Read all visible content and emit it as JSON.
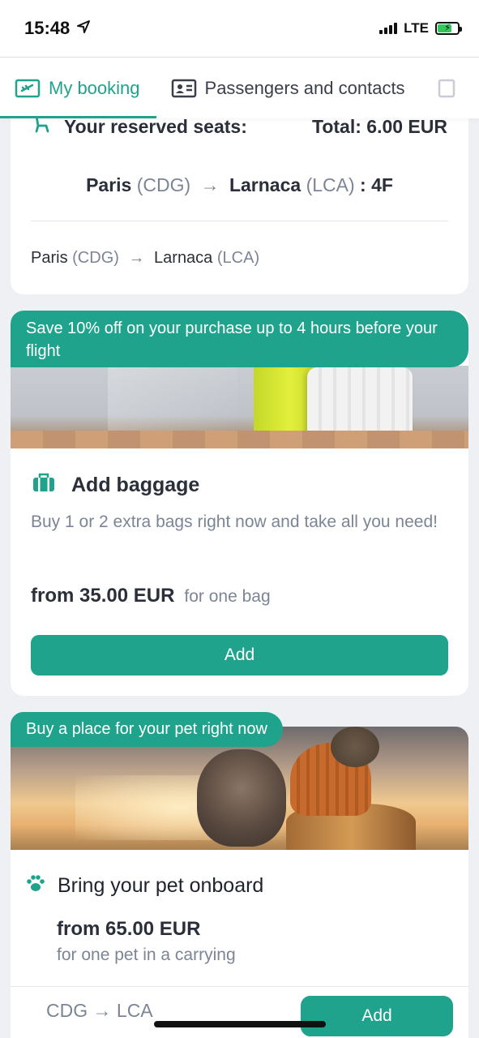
{
  "status_bar": {
    "time": "15:48",
    "network": "LTE"
  },
  "tabs": [
    {
      "label": "My booking",
      "icon": "plane-ticket-icon",
      "active": true
    },
    {
      "label": "Passengers and contacts",
      "icon": "id-card-icon",
      "active": false
    }
  ],
  "seats": {
    "title": "Your reserved seats:",
    "total": "Total: 6.00 EUR",
    "segment_main": {
      "from": "Paris",
      "from_code": "(CDG)",
      "to": "Larnaca",
      "to_code": "(LCA)",
      "seat": ": 4F"
    },
    "segment_sub": {
      "from": "Paris",
      "from_code": "(CDG)",
      "to": "Larnaca",
      "to_code": "(LCA)"
    }
  },
  "baggage": {
    "promo": "Save 10% off on your purchase up to 4 hours before your flight",
    "title": "Add baggage",
    "description": "Buy 1 or 2 extra bags right now and take all you need!",
    "price": "from 35.00 EUR",
    "price_note": "for one bag",
    "button": "Add"
  },
  "pet": {
    "promo": "Buy a place for your pet right now",
    "title": "Bring your pet onboard",
    "price": "from 65.00 EUR",
    "price_note": "for one pet in a carrying",
    "route_from": "CDG",
    "route_to": "LCA",
    "button": "Add"
  },
  "colors": {
    "accent": "#20a38c",
    "muted_text": "#7c8596",
    "primary_text": "#2b2f3a"
  }
}
